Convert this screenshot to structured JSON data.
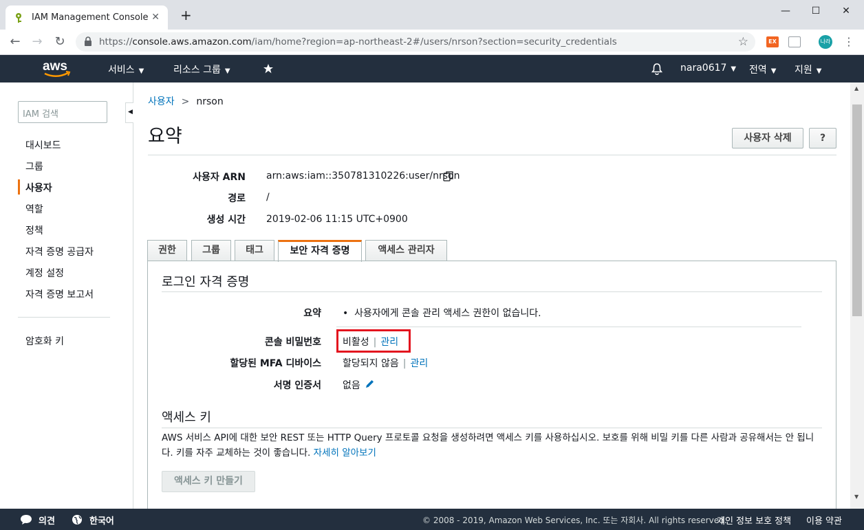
{
  "browser": {
    "tab_title": "IAM Management Console",
    "url_prefix": "https://",
    "url_host": "console.aws.amazon.com",
    "url_path": "/iam/home?region=ap-northeast-2#/users/nrson?section=security_credentials",
    "ext1_label": "EX",
    "profile_label": "나라"
  },
  "aws_nav": {
    "logo_text": "aws",
    "services": "서비스",
    "resource_groups": "리소스 그룹",
    "account": "nara0617",
    "region": "전역",
    "support": "지원"
  },
  "sidebar": {
    "search_placeholder": "IAM 검색",
    "items": [
      {
        "label": "대시보드"
      },
      {
        "label": "그룹"
      },
      {
        "label": "사용자"
      },
      {
        "label": "역할"
      },
      {
        "label": "정책"
      },
      {
        "label": "자격 증명 공급자"
      },
      {
        "label": "계정 설정"
      },
      {
        "label": "자격 증명 보고서"
      }
    ],
    "encryption_keys": "암호화 키"
  },
  "main": {
    "breadcrumb_parent": "사용자",
    "breadcrumb_current": "nrson",
    "title": "요약",
    "delete_user_button": "사용자 삭제",
    "help_button": "?",
    "info": [
      {
        "label": "사용자 ARN",
        "value": "arn:aws:iam::350781310226:user/nrson"
      },
      {
        "label": "경로",
        "value": "/"
      },
      {
        "label": "생성 시간",
        "value": "2019-02-06 11:15 UTC+0900"
      }
    ],
    "tabs": [
      {
        "label": "권한"
      },
      {
        "label": "그룹"
      },
      {
        "label": "태그"
      },
      {
        "label": "보안 자격 증명"
      },
      {
        "label": "액세스 관리자"
      }
    ],
    "login_section": {
      "title": "로그인 자격 증명",
      "summary_label": "요약",
      "summary_value": "사용자에게 콘솔 관리 액세스 권한이 없습니다.",
      "console_pw_label": "콘솔 비밀번호",
      "console_pw_status": "비활성",
      "console_pw_manage": "관리",
      "mfa_label": "할당된 MFA 디바이스",
      "mfa_status": "할당되지 않음",
      "mfa_manage": "관리",
      "cert_label": "서명 인증서",
      "cert_value": "없음"
    },
    "access_keys_section": {
      "title": "액세스 키",
      "description": "AWS 서비스 API에 대한 보안 REST 또는 HTTP Query 프로토콜 요청을 생성하려면 액세스 키를 사용하십시오. 보호를 위해 비밀 키를 다른 사람과 공유해서는 안 됩니다. 키를 자주 교체하는 것이 좋습니다.",
      "learn_more": "자세히 알아보기",
      "create_button": "액세스 키 만들기"
    }
  },
  "footer": {
    "feedback": "의견",
    "language": "한국어",
    "copyright": "© 2008 - 2019, Amazon Web Services, Inc. 또는 자회사. All rights reserved.",
    "privacy": "개인 정보 보호 정책",
    "terms": "이용 약관"
  },
  "colors": {
    "aws_nav_bg": "#232f3e",
    "accent_orange": "#ec7211",
    "link_blue": "#0073bb",
    "highlight_red": "#e3141e"
  }
}
